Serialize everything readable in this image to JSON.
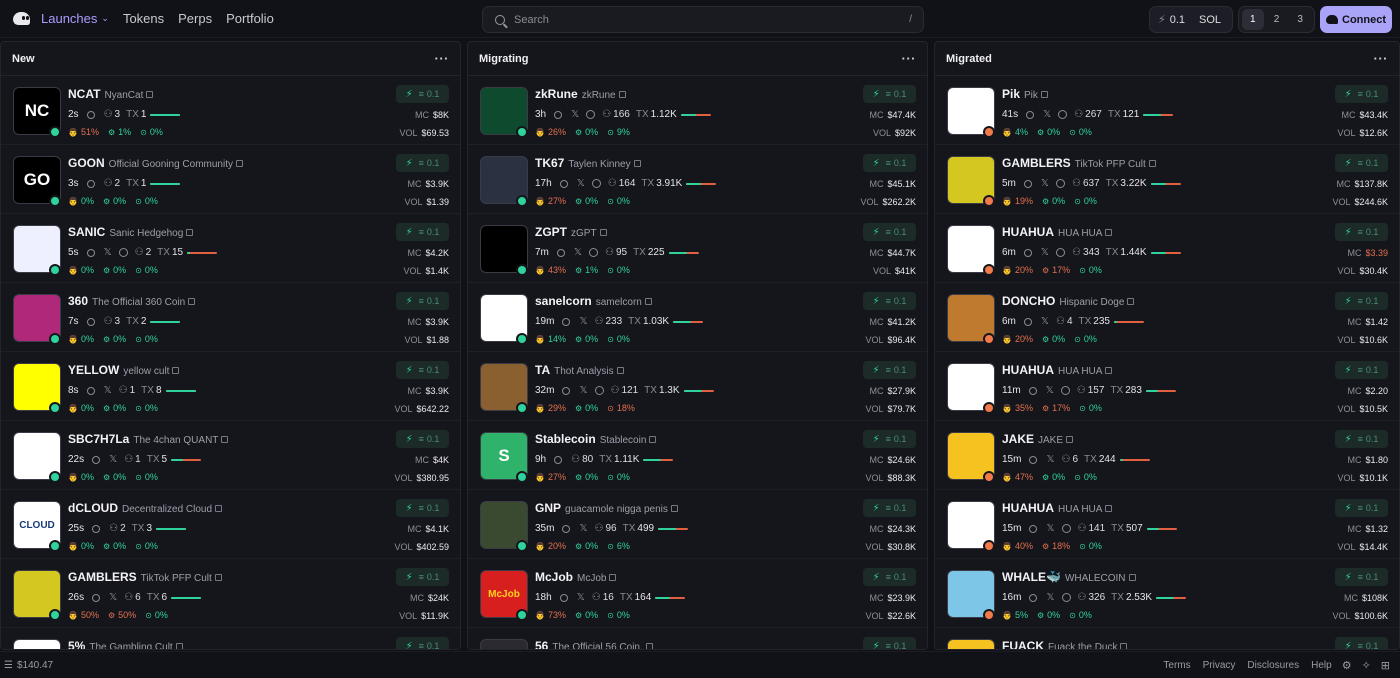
{
  "nav": {
    "items": [
      {
        "label": "Launches",
        "active": true
      },
      {
        "label": "Tokens",
        "active": false
      },
      {
        "label": "Perps",
        "active": false
      },
      {
        "label": "Portfolio",
        "active": false
      }
    ]
  },
  "search": {
    "placeholder": "Search",
    "shortcut": "/"
  },
  "quick_buy": {
    "amount": "0.1",
    "currency": "SOL"
  },
  "presets": [
    "1",
    "2",
    "3"
  ],
  "connect_label": "Connect",
  "colors": {
    "accent": "#a9a4f7",
    "green": "#2fd39b",
    "red": "#e4704f"
  },
  "columns": [
    {
      "title": "New",
      "tokens": [
        {
          "sym": "NCAT",
          "name": "NyanCat",
          "age": "2s",
          "holders": "3",
          "tx": "1",
          "buy_ratio": 1,
          "s1": "51%",
          "s1c": "r",
          "s2": "1%",
          "s2c": "g",
          "s3": "0%",
          "s3c": "g",
          "mc": "$8K",
          "vol": "$69.53",
          "buy": "0.1",
          "av": "NC",
          "avbg": "#000000",
          "avfg": "#ffffff",
          "dot": "#2fd39b",
          "socials": [
            "search"
          ]
        },
        {
          "sym": "GOON",
          "name": "Official Gooning Community",
          "age": "3s",
          "holders": "2",
          "tx": "1",
          "buy_ratio": 1,
          "s1": "0%",
          "s1c": "g",
          "s2": "0%",
          "s2c": "g",
          "s3": "0%",
          "s3c": "g",
          "mc": "$3.9K",
          "vol": "$1.39",
          "buy": "0.1",
          "av": "GO",
          "avbg": "#000000",
          "avfg": "#ffffff",
          "dot": "#2fd39b",
          "socials": [
            "search"
          ]
        },
        {
          "sym": "SANIC",
          "name": "Sanic Hedgehog",
          "age": "5s",
          "holders": "2",
          "tx": "15",
          "buy_ratio": 0.1,
          "s1": "0%",
          "s1c": "g",
          "s2": "0%",
          "s2c": "g",
          "s3": "0%",
          "s3c": "g",
          "mc": "$4.2K",
          "vol": "$1.4K",
          "buy": "0.1",
          "av": "",
          "avbg": "#eef0ff",
          "avfg": "#2a3aa0",
          "dot": "#2fd39b",
          "socials": [
            "search",
            "x",
            "web"
          ]
        },
        {
          "sym": "360",
          "name": "The Official 360 Coin",
          "age": "7s",
          "holders": "3",
          "tx": "2",
          "buy_ratio": 1,
          "s1": "0%",
          "s1c": "g",
          "s2": "0%",
          "s2c": "g",
          "s3": "0%",
          "s3c": "g",
          "mc": "$3.9K",
          "vol": "$1.88",
          "buy": "0.1",
          "av": "",
          "avbg": "#b0287a",
          "avfg": "#ffffff",
          "dot": "#2fd39b",
          "socials": [
            "search"
          ]
        },
        {
          "sym": "YELLOW",
          "name": "yellow cult",
          "age": "8s",
          "holders": "1",
          "tx": "8",
          "buy_ratio": 1,
          "s1": "0%",
          "s1c": "g",
          "s2": "0%",
          "s2c": "g",
          "s3": "0%",
          "s3c": "g",
          "mc": "$3.9K",
          "vol": "$642.22",
          "buy": "0.1",
          "av": "",
          "avbg": "#ffff00",
          "avfg": "#000000",
          "dot": "#2fd39b",
          "socials": [
            "search",
            "x"
          ]
        },
        {
          "sym": "SBC7H7La",
          "name": "The 4chan QUANT",
          "age": "22s",
          "holders": "1",
          "tx": "5",
          "buy_ratio": 0.4,
          "s1": "0%",
          "s1c": "g",
          "s2": "0%",
          "s2c": "g",
          "s3": "0%",
          "s3c": "g",
          "mc": "$4K",
          "vol": "$380.95",
          "buy": "0.1",
          "av": "",
          "avbg": "#ffffff",
          "avfg": "#000000",
          "dot": "#2fd39b",
          "socials": [
            "search",
            "x"
          ]
        },
        {
          "sym": "dCLOUD",
          "name": "Decentralized Cloud",
          "age": "25s",
          "holders": "2",
          "tx": "3",
          "buy_ratio": 1,
          "s1": "0%",
          "s1c": "g",
          "s2": "0%",
          "s2c": "g",
          "s3": "0%",
          "s3c": "g",
          "mc": "$4.1K",
          "vol": "$402.59",
          "buy": "0.1",
          "av": "CLOUD",
          "avbg": "#ffffff",
          "avfg": "#1a3a7a",
          "dot": "#2fd39b",
          "socials": [
            "search"
          ]
        },
        {
          "sym": "GAMBLERS",
          "name": "TikTok PFP Cult",
          "age": "26s",
          "holders": "6",
          "tx": "6",
          "buy_ratio": 1,
          "s1": "50%",
          "s1c": "r",
          "s2": "50%",
          "s2c": "r",
          "s3": "0%",
          "s3c": "g",
          "mc": "$24K",
          "vol": "$11.9K",
          "buy": "0.1",
          "av": "",
          "avbg": "#d4c820",
          "avfg": "#000000",
          "dot": "#2fd39b",
          "socials": [
            "search",
            "x"
          ]
        },
        {
          "sym": "5%",
          "name": "The Gambling Cult",
          "age": "",
          "holders": "",
          "tx": "",
          "buy_ratio": 1,
          "s1": "",
          "s1c": "g",
          "s2": "",
          "s2c": "g",
          "s3": "",
          "s3c": "g",
          "mc": "",
          "vol": "",
          "buy": "0.1",
          "av": "",
          "avbg": "#ffffff",
          "avfg": "#000000",
          "dot": "#2fd39b",
          "socials": []
        }
      ]
    },
    {
      "title": "Migrating",
      "tokens": [
        {
          "sym": "zkRune",
          "name": "zkRune",
          "age": "3h",
          "holders": "166",
          "tx": "1.12K",
          "buy_ratio": 0.5,
          "s1": "26%",
          "s1c": "r",
          "s2": "0%",
          "s2c": "g",
          "s3": "9%",
          "s3c": "g",
          "mc": "$47.4K",
          "vol": "$92K",
          "buy": "0.1",
          "av": "",
          "avbg": "#0d4a2e",
          "avfg": "#3fe08f",
          "dot": "#2fd39b",
          "socials": [
            "search",
            "x",
            "web"
          ]
        },
        {
          "sym": "TK67",
          "name": "Taylen Kinney",
          "age": "17h",
          "holders": "164",
          "tx": "3.91K",
          "buy_ratio": 0.5,
          "s1": "27%",
          "s1c": "r",
          "s2": "0%",
          "s2c": "g",
          "s3": "0%",
          "s3c": "g",
          "mc": "$45.1K",
          "vol": "$262.2K",
          "buy": "0.1",
          "av": "",
          "avbg": "#2a3140",
          "avfg": "#ffffff",
          "dot": "#2fd39b",
          "socials": [
            "search",
            "x",
            "web"
          ]
        },
        {
          "sym": "ZGPT",
          "name": "zGPT",
          "age": "7m",
          "holders": "95",
          "tx": "225",
          "buy_ratio": 0.6,
          "s1": "43%",
          "s1c": "r",
          "s2": "1%",
          "s2c": "g",
          "s3": "0%",
          "s3c": "g",
          "mc": "$44.7K",
          "vol": "$41K",
          "buy": "0.1",
          "av": "",
          "avbg": "#000000",
          "avfg": "#5aa0ff",
          "dot": "#2fd39b",
          "socials": [
            "search",
            "x",
            "web"
          ]
        },
        {
          "sym": "sanelcorn",
          "name": "samelcorn",
          "age": "19m",
          "holders": "233",
          "tx": "1.03K",
          "buy_ratio": 0.6,
          "s1": "14%",
          "s1c": "g",
          "s2": "0%",
          "s2c": "g",
          "s3": "0%",
          "s3c": "g",
          "mc": "$41.2K",
          "vol": "$96.4K",
          "buy": "0.1",
          "av": "",
          "avbg": "#ffffff",
          "avfg": "#6a3aa0",
          "dot": "#2fd39b",
          "socials": [
            "search",
            "x"
          ]
        },
        {
          "sym": "TA",
          "name": "Thot Analysis",
          "age": "32m",
          "holders": "121",
          "tx": "1.3K",
          "buy_ratio": 0.6,
          "s1": "29%",
          "s1c": "r",
          "s2": "0%",
          "s2c": "g",
          "s3": "18%",
          "s3c": "r",
          "mc": "$27.9K",
          "vol": "$79.7K",
          "buy": "0.1",
          "av": "",
          "avbg": "#8a6030",
          "avfg": "#ffffff",
          "dot": "#2fd39b",
          "socials": [
            "search",
            "x",
            "web"
          ]
        },
        {
          "sym": "Stablecoin",
          "name": "Stablecoin",
          "age": "9h",
          "holders": "80",
          "tx": "1.11K",
          "buy_ratio": 0.6,
          "s1": "27%",
          "s1c": "r",
          "s2": "0%",
          "s2c": "g",
          "s3": "0%",
          "s3c": "g",
          "mc": "$24.6K",
          "vol": "$88.3K",
          "buy": "0.1",
          "av": "S",
          "avbg": "#2fb36a",
          "avfg": "#ffffff",
          "dot": "#2fd39b",
          "socials": [
            "search"
          ]
        },
        {
          "sym": "GNP",
          "name": "guacamole nigga penis",
          "age": "35m",
          "holders": "96",
          "tx": "499",
          "buy_ratio": 0.6,
          "s1": "20%",
          "s1c": "r",
          "s2": "0%",
          "s2c": "g",
          "s3": "6%",
          "s3c": "g",
          "mc": "$24.3K",
          "vol": "$30.8K",
          "buy": "0.1",
          "av": "",
          "avbg": "#3a4a30",
          "avfg": "#ffffff",
          "dot": "#2fd39b",
          "socials": [
            "search",
            "x"
          ]
        },
        {
          "sym": "McJob",
          "name": "McJob",
          "age": "18h",
          "holders": "16",
          "tx": "164",
          "buy_ratio": 0.5,
          "s1": "73%",
          "s1c": "r",
          "s2": "0%",
          "s2c": "g",
          "s3": "0%",
          "s3c": "g",
          "mc": "$23.9K",
          "vol": "$22.6K",
          "buy": "0.1",
          "av": "McJob",
          "avbg": "#d81f1f",
          "avfg": "#ffd21f",
          "dot": "#2fd39b",
          "socials": [
            "search",
            "x"
          ]
        },
        {
          "sym": "56",
          "name": "The Official 56 Coin.",
          "age": "",
          "holders": "",
          "tx": "",
          "buy_ratio": 1,
          "s1": "",
          "s1c": "g",
          "s2": "",
          "s2c": "g",
          "s3": "",
          "s3c": "g",
          "mc": "",
          "vol": "",
          "buy": "0.1",
          "av": "",
          "avbg": "#2a2a30",
          "avfg": "#ffffff",
          "dot": "#2fd39b",
          "socials": []
        }
      ]
    },
    {
      "title": "Migrated",
      "tokens": [
        {
          "sym": "Pik",
          "name": "Pik",
          "age": "41s",
          "holders": "267",
          "tx": "121",
          "buy_ratio": 0.6,
          "s1": "4%",
          "s1c": "g",
          "s2": "0%",
          "s2c": "g",
          "s3": "0%",
          "s3c": "g",
          "mc": "$43.4K",
          "vol": "$12.6K",
          "buy": "0.1",
          "av": "",
          "avbg": "#ffffff",
          "avfg": "#1aa050",
          "dot": "#f07a4a",
          "socials": [
            "search",
            "x",
            "web"
          ]
        },
        {
          "sym": "GAMBLERS",
          "name": "TikTok PFP Cult",
          "age": "5m",
          "holders": "637",
          "tx": "3.22K",
          "buy_ratio": 0.5,
          "s1": "19%",
          "s1c": "r",
          "s2": "0%",
          "s2c": "g",
          "s3": "0%",
          "s3c": "g",
          "mc": "$137.8K",
          "vol": "$244.6K",
          "buy": "0.1",
          "av": "",
          "avbg": "#d4c820",
          "avfg": "#000000",
          "dot": "#f07a4a",
          "socials": [
            "search",
            "x",
            "web"
          ]
        },
        {
          "sym": "HUAHUA",
          "name": "HUA HUA",
          "age": "6m",
          "holders": "343",
          "tx": "1.44K",
          "buy_ratio": 0.5,
          "s1": "20%",
          "s1c": "r",
          "s2": "17%",
          "s2c": "r",
          "s3": "0%",
          "s3c": "g",
          "mc": "$3.39",
          "vol": "$30.4K",
          "buy": "0.1",
          "av": "",
          "avbg": "#ffffff",
          "avfg": "#000000",
          "dot": "#f07a4a",
          "socials": [
            "search",
            "x",
            "web"
          ],
          "mc_red": true
        },
        {
          "sym": "DONCHO",
          "name": "Hispanic Doge",
          "age": "6m",
          "holders": "4",
          "tx": "235",
          "buy_ratio": 0.1,
          "s1": "20%",
          "s1c": "r",
          "s2": "0%",
          "s2c": "g",
          "s3": "0%",
          "s3c": "g",
          "mc": "$1.42",
          "vol": "$10.6K",
          "buy": "0.1",
          "av": "",
          "avbg": "#c07a30",
          "avfg": "#ffffff",
          "dot": "#f07a4a",
          "socials": [
            "search",
            "x"
          ]
        },
        {
          "sym": "HUAHUA",
          "name": "HUA HUA",
          "age": "11m",
          "holders": "157",
          "tx": "283",
          "buy_ratio": 0.4,
          "s1": "35%",
          "s1c": "r",
          "s2": "17%",
          "s2c": "r",
          "s3": "0%",
          "s3c": "g",
          "mc": "$2.20",
          "vol": "$10.5K",
          "buy": "0.1",
          "av": "",
          "avbg": "#ffffff",
          "avfg": "#000000",
          "dot": "#f07a4a",
          "socials": [
            "search",
            "x",
            "web"
          ]
        },
        {
          "sym": "JAKE",
          "name": "JAKE",
          "age": "15m",
          "holders": "6",
          "tx": "244",
          "buy_ratio": 0.1,
          "s1": "47%",
          "s1c": "r",
          "s2": "0%",
          "s2c": "g",
          "s3": "0%",
          "s3c": "g",
          "mc": "$1.80",
          "vol": "$10.1K",
          "buy": "0.1",
          "av": "",
          "avbg": "#f5c21f",
          "avfg": "#000000",
          "dot": "#f07a4a",
          "socials": [
            "search",
            "x"
          ]
        },
        {
          "sym": "HUAHUA",
          "name": "HUA HUA",
          "age": "15m",
          "holders": "141",
          "tx": "507",
          "buy_ratio": 0.4,
          "s1": "40%",
          "s1c": "r",
          "s2": "18%",
          "s2c": "r",
          "s3": "0%",
          "s3c": "g",
          "mc": "$1.32",
          "vol": "$14.4K",
          "buy": "0.1",
          "av": "",
          "avbg": "#ffffff",
          "avfg": "#000000",
          "dot": "#f07a4a",
          "socials": [
            "search",
            "x",
            "web"
          ]
        },
        {
          "sym": "WHALE🐳",
          "name": "WHALECOIN",
          "age": "16m",
          "holders": "326",
          "tx": "2.53K",
          "buy_ratio": 0.6,
          "s1": "5%",
          "s1c": "g",
          "s2": "0%",
          "s2c": "g",
          "s3": "0%",
          "s3c": "g",
          "mc": "$108K",
          "vol": "$100.6K",
          "buy": "0.1",
          "av": "",
          "avbg": "#7ec6e8",
          "avfg": "#1a3a7a",
          "dot": "#f07a4a",
          "socials": [
            "search",
            "x",
            "web"
          ]
        },
        {
          "sym": "FUACK",
          "name": "Fuack the Duck",
          "age": "",
          "holders": "",
          "tx": "",
          "buy_ratio": 1,
          "s1": "",
          "s1c": "g",
          "s2": "",
          "s2c": "g",
          "s3": "",
          "s3c": "g",
          "mc": "",
          "vol": "",
          "buy": "0.1",
          "av": "",
          "avbg": "#f5c21f",
          "avfg": "#000000",
          "dot": "#f07a4a",
          "socials": []
        }
      ]
    }
  ],
  "labels": {
    "mc": "MC",
    "vol": "VOL",
    "tx": "TX"
  },
  "footer": {
    "price": "$140.47",
    "links": [
      "Terms",
      "Privacy",
      "Disclosures",
      "Help"
    ]
  }
}
